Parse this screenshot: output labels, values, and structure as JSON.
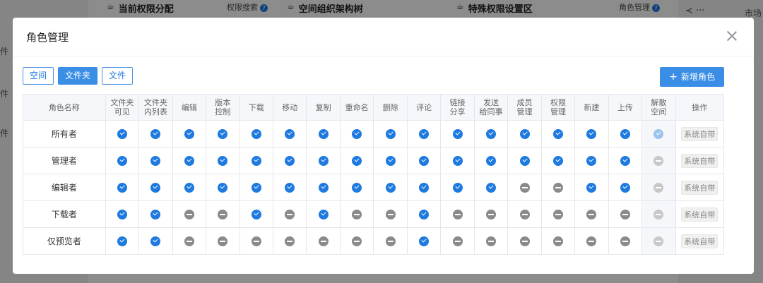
{
  "background": {
    "cards": [
      {
        "title": "当前权限分配",
        "right": "权限搜索"
      },
      {
        "title": "空间组织架构树",
        "right": ""
      },
      {
        "title": "特殊权限设置区",
        "right": "角色管理"
      }
    ],
    "left_labels": [
      "件",
      "件",
      "件"
    ],
    "right_labels": [
      "市场",
      "场",
      "场"
    ],
    "tools": "≺ ···"
  },
  "modal": {
    "title": "角色管理",
    "type_tabs": [
      {
        "label": "空间",
        "active": false
      },
      {
        "label": "文件夹",
        "active": true
      },
      {
        "label": "文件",
        "active": false
      }
    ],
    "add_button": "新增角色",
    "columns": [
      "角色名称",
      "文件夹\n可见",
      "文件夹\n内列表",
      "编辑",
      "版本\n控制",
      "下载",
      "移动",
      "复制",
      "重命名",
      "删除",
      "评论",
      "链接\n分享",
      "发送\n给同事",
      "成员\n管理",
      "权限\n管理",
      "新建",
      "上传",
      "解散\n空间",
      "操作"
    ],
    "rows": [
      {
        "name": "所有者",
        "perms": [
          1,
          1,
          1,
          1,
          1,
          1,
          1,
          1,
          1,
          1,
          1,
          1,
          1,
          1,
          1,
          1,
          1
        ],
        "action": "系统自带"
      },
      {
        "name": "管理者",
        "perms": [
          1,
          1,
          1,
          1,
          1,
          1,
          1,
          1,
          1,
          1,
          1,
          1,
          1,
          1,
          1,
          1,
          0
        ],
        "action": "系统自带"
      },
      {
        "name": "编辑者",
        "perms": [
          1,
          1,
          1,
          1,
          1,
          1,
          1,
          1,
          1,
          1,
          1,
          1,
          0,
          0,
          1,
          1,
          0
        ],
        "action": "系统自带"
      },
      {
        "name": "下载者",
        "perms": [
          1,
          1,
          0,
          0,
          1,
          0,
          1,
          0,
          0,
          1,
          0,
          0,
          0,
          0,
          0,
          0,
          0
        ],
        "action": "系统自带"
      },
      {
        "name": "仅预览者",
        "perms": [
          1,
          1,
          0,
          0,
          0,
          0,
          0,
          0,
          0,
          1,
          0,
          0,
          0,
          0,
          0,
          0,
          0
        ],
        "action": "系统自带"
      }
    ]
  }
}
